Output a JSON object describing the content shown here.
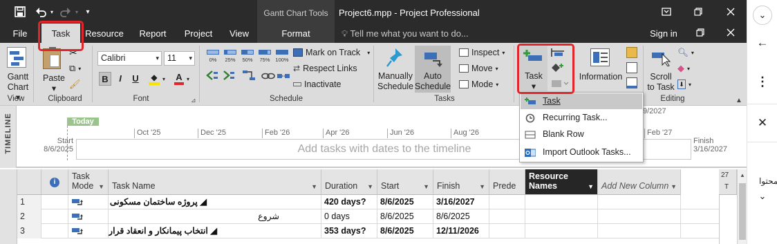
{
  "window": {
    "context_title": "Gantt Chart Tools",
    "doc_title": "Project6.mpp - Project Professional",
    "signin": "Sign in"
  },
  "tabs": [
    "File",
    "Task",
    "Resource",
    "Report",
    "Project",
    "View",
    "Format"
  ],
  "tell_me": "Tell me what you want to do...",
  "ribbon": {
    "view_group": {
      "button": "Gantt Chart",
      "button_l1": "Gantt",
      "button_l2": "Chart",
      "label": "View"
    },
    "clipboard": {
      "paste": "Paste",
      "label": "Clipboard"
    },
    "font": {
      "name": "Calibri",
      "size": "11",
      "bold": "B",
      "italic": "I",
      "underline": "U",
      "label": "Font"
    },
    "schedule": {
      "pct": [
        "0%",
        "25%",
        "50%",
        "75%",
        "100%"
      ],
      "mark_on_track": "Mark on Track",
      "respect_links": "Respect Links",
      "inactivate": "Inactivate",
      "label": "Schedule"
    },
    "tasks": {
      "manually": "Manually Schedule",
      "manually_l1": "Manually",
      "manually_l2": "Schedule",
      "auto": "Auto Schedule",
      "auto_l1": "Auto",
      "auto_l2": "Schedule",
      "inspect": "Inspect",
      "move": "Move",
      "mode": "Mode",
      "label": "Tasks"
    },
    "insert": {
      "task": "Task"
    },
    "properties": {
      "information": "Information"
    },
    "editing": {
      "scroll_l1": "Scroll",
      "scroll_l2": "to Task",
      "label": "Editing"
    }
  },
  "timeline": {
    "side_label": "TIMELINE",
    "today": "Today",
    "start_label": "Start",
    "start_date": "8/6/2025",
    "finish_label": "Finish",
    "finish_date": "3/16/2027",
    "months": [
      "Oct '25",
      "Dec '25",
      "Feb '26",
      "Apr '26",
      "Jun '26",
      "Aug '26",
      "Feb '27"
    ],
    "placeholder": "Add tasks with dates to the timeline",
    "partial_date": "9/2027"
  },
  "dropdown": {
    "items": [
      "Task",
      "Recurring Task...",
      "Blank Row",
      "Import Outlook Tasks..."
    ],
    "selected": 0
  },
  "grid": {
    "headers": {
      "mode_l1": "Task",
      "mode_l2": "Mode",
      "name": "Task Name",
      "duration": "Duration",
      "start": "Start",
      "finish": "Finish",
      "pred": "Prede",
      "res_l1": "Resource",
      "res_l2": "Names",
      "add": "Add New Column",
      "chart_day": "27",
      "chart_t": "T"
    },
    "rows": [
      {
        "id": "1",
        "name": "◢ پروژه ساختمان مسکونی",
        "duration": "420 days?",
        "start": "8/6/2025",
        "finish": "3/16/2027",
        "bold": true
      },
      {
        "id": "2",
        "name": "شروع",
        "duration": "0 days",
        "start": "8/6/2025",
        "finish": "8/6/2025",
        "bold": false
      },
      {
        "id": "3",
        "name": "◢ انتخاب پیمانکار و انعقاد قرارداد",
        "duration": "353 days?",
        "start": "8/6/2025",
        "finish": "12/11/2026",
        "bold": true
      }
    ]
  },
  "side_text": "محتوا",
  "colors": {
    "highlight": "#e0262b",
    "ribbon_bg": "#dcdcdc",
    "titlebar": "#2b2b2b",
    "today": "#9ac48c"
  }
}
